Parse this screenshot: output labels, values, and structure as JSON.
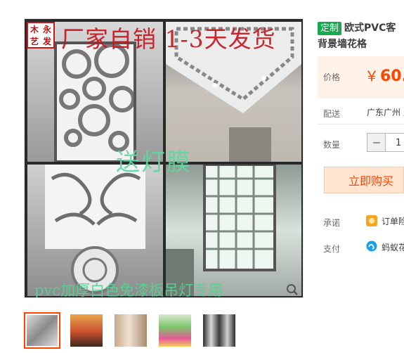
{
  "main_image": {
    "stamp_chars": [
      "木",
      "永",
      "艺",
      "发"
    ],
    "overlay_top": "厂家自销 1-3天发货",
    "overlay_mid": "送灯膜",
    "overlay_bottom": "pvc加厚白色免漆板吊灯专用"
  },
  "thumbnails": [
    {
      "name": "thumb-1",
      "active": true
    },
    {
      "name": "thumb-2",
      "active": false
    },
    {
      "name": "thumb-3",
      "active": false
    },
    {
      "name": "thumb-4",
      "active": false
    },
    {
      "name": "thumb-5",
      "active": false
    }
  ],
  "product": {
    "tag": "定制",
    "title": "欧式PVC客",
    "subtitle": "背景墙花格"
  },
  "price": {
    "label": "价格",
    "currency": "￥",
    "value": "60."
  },
  "delivery": {
    "label": "配送",
    "value": "广东广州 至"
  },
  "quantity": {
    "label": "数量",
    "value": "1"
  },
  "buy_button": "立即购买",
  "promise": {
    "label": "承诺",
    "value": "订单险"
  },
  "payment": {
    "label": "支付",
    "value": "蚂蚁花"
  },
  "colors": {
    "accent": "#ff4400",
    "tag_green": "#17a94d",
    "price_bg": "#fff2e8"
  }
}
